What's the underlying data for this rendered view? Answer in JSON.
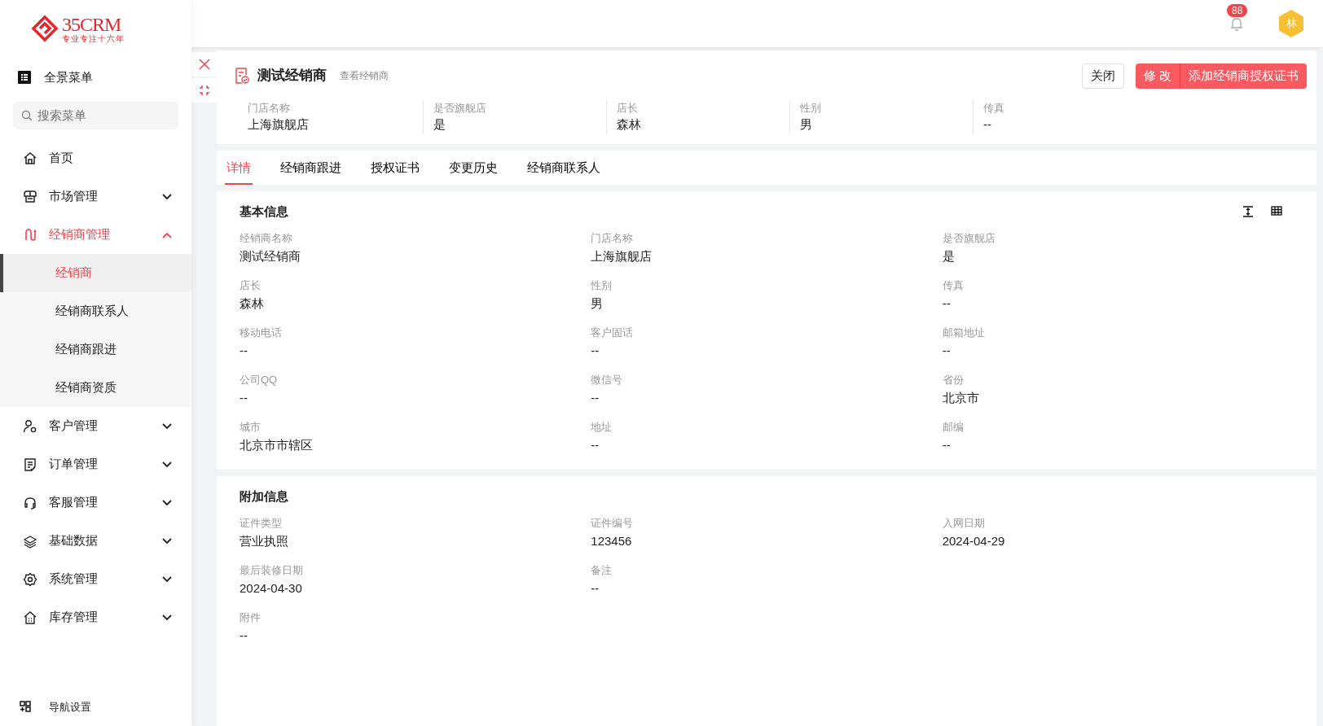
{
  "logo": {
    "name": "35CRM",
    "tagline": "专业专注十六年"
  },
  "header": {
    "notification_count": "88",
    "avatar": "林"
  },
  "sidebar": {
    "full_menu": "全景菜单",
    "search": {
      "placeholder": "搜索菜单"
    },
    "items": [
      {
        "label": "首页",
        "selected": false
      },
      {
        "label": "市场管理",
        "selected": false,
        "expanded": false
      },
      {
        "label": "经销商管理",
        "selected": true,
        "expanded": true,
        "children": [
          {
            "label": "经销商",
            "selected": true
          },
          {
            "label": "经销商联系人",
            "selected": false
          },
          {
            "label": "经销商跟进",
            "selected": false
          },
          {
            "label": "经销商资质",
            "selected": false
          }
        ]
      },
      {
        "label": "客户管理",
        "selected": false,
        "expanded": false
      },
      {
        "label": "订单管理",
        "selected": false,
        "expanded": false
      },
      {
        "label": "客服管理",
        "selected": false,
        "expanded": false
      },
      {
        "label": "基础数据",
        "selected": false,
        "expanded": false
      },
      {
        "label": "系统管理",
        "selected": false,
        "expanded": false
      },
      {
        "label": "库存管理",
        "selected": false,
        "expanded": false
      }
    ],
    "footer": "导航设置"
  },
  "page": {
    "title": "测试经销商",
    "subtitle": "查看经销商",
    "buttons": [
      {
        "label": "关闭",
        "kind": "plain"
      },
      {
        "label": "修 改",
        "kind": "primary"
      },
      {
        "label": "添加经销商授权证书",
        "kind": "primary"
      }
    ]
  },
  "summary": [
    {
      "label": "门店名称",
      "value": "上海旗舰店"
    },
    {
      "label": "是否旗舰店",
      "value": "是"
    },
    {
      "label": "店长",
      "value": "森林"
    },
    {
      "label": "性别",
      "value": "男"
    },
    {
      "label": "传真",
      "value": "--"
    }
  ],
  "tabs": [
    {
      "label": "详情",
      "selected": true
    },
    {
      "label": "经销商跟进",
      "selected": false
    },
    {
      "label": "授权证书",
      "selected": false
    },
    {
      "label": "变更历史",
      "selected": false
    },
    {
      "label": "经销商联系人",
      "selected": false
    }
  ],
  "sections": [
    {
      "title": "基本信息",
      "fields": [
        {
          "label": "经销商名称",
          "value": "测试经销商"
        },
        {
          "label": "门店名称",
          "value": "上海旗舰店"
        },
        {
          "label": "是否旗舰店",
          "value": "是"
        },
        {
          "label": "店长",
          "value": "森林"
        },
        {
          "label": "性别",
          "value": "男"
        },
        {
          "label": "传真",
          "value": "--"
        },
        {
          "label": "移动电话",
          "value": "--"
        },
        {
          "label": "客户固话",
          "value": "--"
        },
        {
          "label": "邮箱地址",
          "value": "--"
        },
        {
          "label": "公司QQ",
          "value": "--"
        },
        {
          "label": "微信号",
          "value": "--"
        },
        {
          "label": "省份",
          "value": "北京市"
        },
        {
          "label": "城市",
          "value": "北京市市辖区"
        },
        {
          "label": "地址",
          "value": "--"
        },
        {
          "label": "邮编",
          "value": "--"
        }
      ]
    },
    {
      "title": "附加信息",
      "fields": [
        {
          "label": "证件类型",
          "value": "营业执照"
        },
        {
          "label": "证件编号",
          "value": "123456"
        },
        {
          "label": "入网日期",
          "value": "2024-04-29"
        },
        {
          "label": "最后装修日期",
          "value": "2024-04-30"
        },
        {
          "label": "备注",
          "value": "--"
        },
        {
          "label": "附件",
          "value": "--",
          "new_row": true
        }
      ]
    }
  ]
}
